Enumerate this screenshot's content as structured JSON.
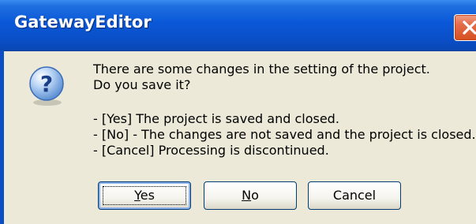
{
  "window": {
    "title": "GatewayEditor"
  },
  "icons": {
    "dialog": "question-icon",
    "close": "close-icon"
  },
  "message": {
    "line1": "There are some changes in the setting of the project.",
    "line2": "Do you save it?",
    "line3": "- [Yes] The project is saved and closed.",
    "line4": "- [No] - The changes are not saved and the project is closed.",
    "line5": "- [Cancel] Processing is discontinued."
  },
  "buttons": {
    "yes": {
      "mnemonic": "Y",
      "rest": "es"
    },
    "no": {
      "mnemonic": "N",
      "rest": "o"
    },
    "cancel": "Cancel"
  },
  "colors": {
    "titlebar": "#0a58d8",
    "close_button": "#d5501f",
    "dialog_background": "#ece9d8",
    "button_border": "#003c74"
  }
}
